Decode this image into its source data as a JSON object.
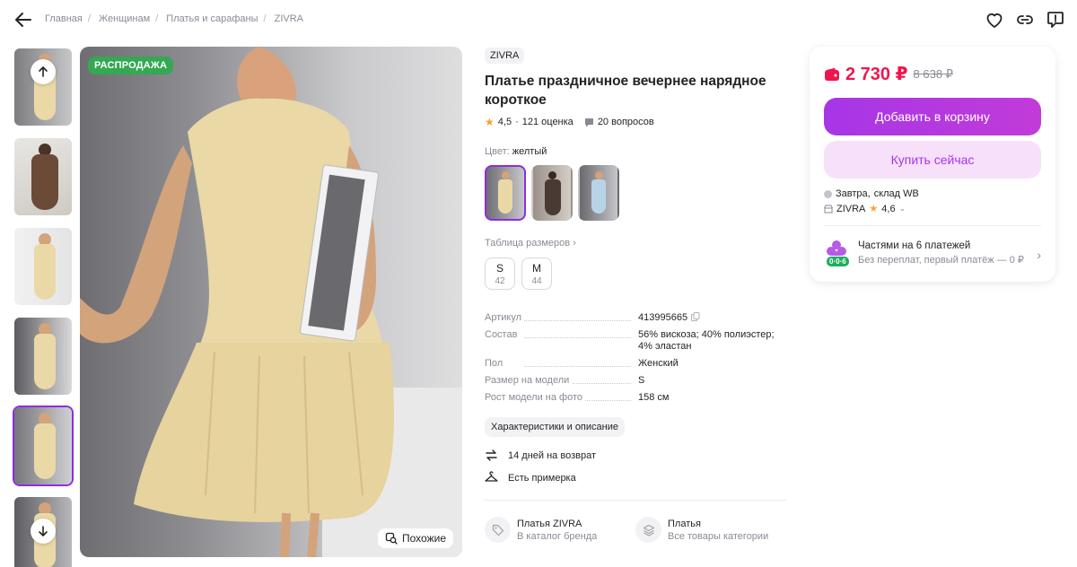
{
  "breadcrumbs": [
    "Главная",
    "Женщинам",
    "Платья и сарафаны",
    "ZIVRA"
  ],
  "gallery": {
    "sale_badge": "РАСПРОДАЖА",
    "similar_label": "Похожие",
    "thumb_count": 6,
    "active_thumb": 5
  },
  "product": {
    "brand": "ZIVRA",
    "title": "Платье праздничное вечернее нарядное короткое",
    "rating": "4,5",
    "rating_sep": "·",
    "reviews": "121 оценка",
    "questions": "20 вопросов",
    "color_label": "Цвет:",
    "color_value": "желтый",
    "size_table": "Таблица размеров",
    "sizes": [
      {
        "size": "S",
        "ru": "42"
      },
      {
        "size": "M",
        "ru": "44"
      }
    ],
    "params": [
      {
        "k": "Артикул",
        "v": "413995665"
      },
      {
        "k": "Состав",
        "v": "56% вискоза; 40% полиэстер; 4% эластан"
      },
      {
        "k": "Пол",
        "v": "Женский"
      },
      {
        "k": "Размер на модели",
        "v": "S"
      },
      {
        "k": "Рост модели на фото",
        "v": "158 см"
      }
    ],
    "desc_button": "Характеристики и описание",
    "return_text": "14 дней на возврат",
    "fitting_text": "Есть примерка",
    "links": [
      {
        "t1": "Платья ZIVRA",
        "t2": "В каталог бренда"
      },
      {
        "t1": "Платья",
        "t2": "Все товары категории"
      }
    ]
  },
  "buy": {
    "price": "2 730 ₽",
    "old_price": "8 638 ₽",
    "cart": "Добавить в корзину",
    "buy_now": "Купить сейчас",
    "delivery_day": "Завтра,",
    "delivery_rest": "склад WB",
    "seller": "ZIVRA",
    "seller_rating": "4,6",
    "installment_title": "Частями на 6 платежей",
    "installment_sub": "Без переплат, первый платёж — 0 ₽",
    "installment_badge": "0·0·6"
  },
  "colors": {
    "accent": "#a636e6",
    "price": "#f1154f",
    "sale": "#34a853",
    "star": "#ff9e2c"
  }
}
